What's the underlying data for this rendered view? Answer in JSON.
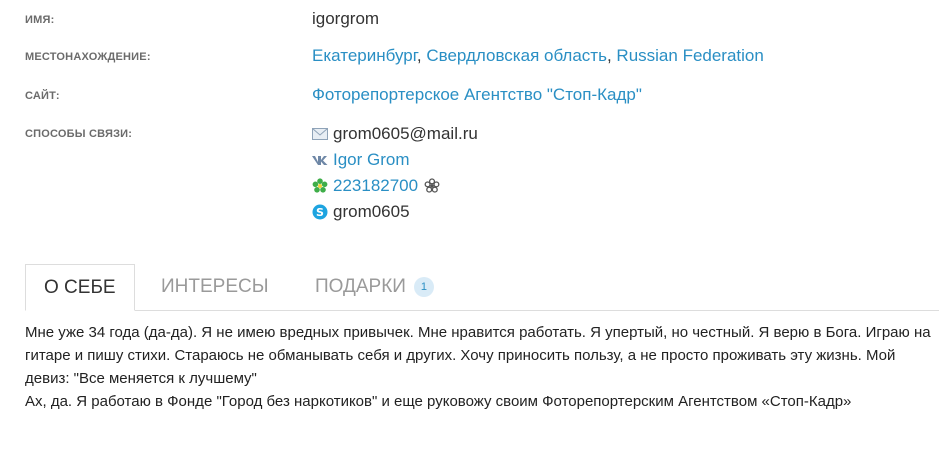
{
  "profile": {
    "name_label": "ИМЯ:",
    "name": "igorgrom",
    "location_label": "МЕСТОНАХОЖДЕНИЕ:",
    "location": {
      "city": "Екатеринбург",
      "region": "Свердловская область",
      "country": "Russian Federation",
      "separator": ","
    },
    "site_label": "САЙТ:",
    "site": "Фоторепортерское Агентство \"Стоп-Кадр\"",
    "contacts_label": "СПОСОБЫ СВЯЗИ:",
    "contacts": {
      "email": "grom0605@mail.ru",
      "vk": "Igor Grom",
      "icq": "223182700",
      "skype": "grom0605"
    }
  },
  "tabs": [
    {
      "label": "О СЕБЕ",
      "active": true
    },
    {
      "label": "ИНТЕРЕСЫ",
      "active": false
    },
    {
      "label": "ПОДАРКИ",
      "active": false,
      "badge": "1"
    }
  ],
  "about": {
    "paragraph1": "Мне уже 34 года (да-да). Я не имею вредных привычек. Мне нравится работать. Я упертый, но честный. Я верю в Бога. Играю на гитаре и пишу стихи. Стараюсь не обманывать себя и других. Хочу приносить пользу, а не просто проживать эту жизнь. Мой девиз: \"Все меняется к лучшему\"",
    "paragraph2": "Ах, да. Я работаю в Фонде \"Город без наркотиков\" и еще руковожу своим Фоторепортерским Агентством «Стоп-Кадр»"
  },
  "colors": {
    "link": "#2a8fc4",
    "label": "#6b6b6b",
    "tab_inactive": "#9a9a9a",
    "badge_bg": "#d9ebf7",
    "icq_green": "#3fae49",
    "skype_blue": "#1da4e0"
  },
  "icons": {
    "email": "mail-icon",
    "vk": "vk-icon",
    "icq": "icq-flower-icon",
    "icq_status": "icq-status-icon",
    "skype": "skype-icon"
  }
}
